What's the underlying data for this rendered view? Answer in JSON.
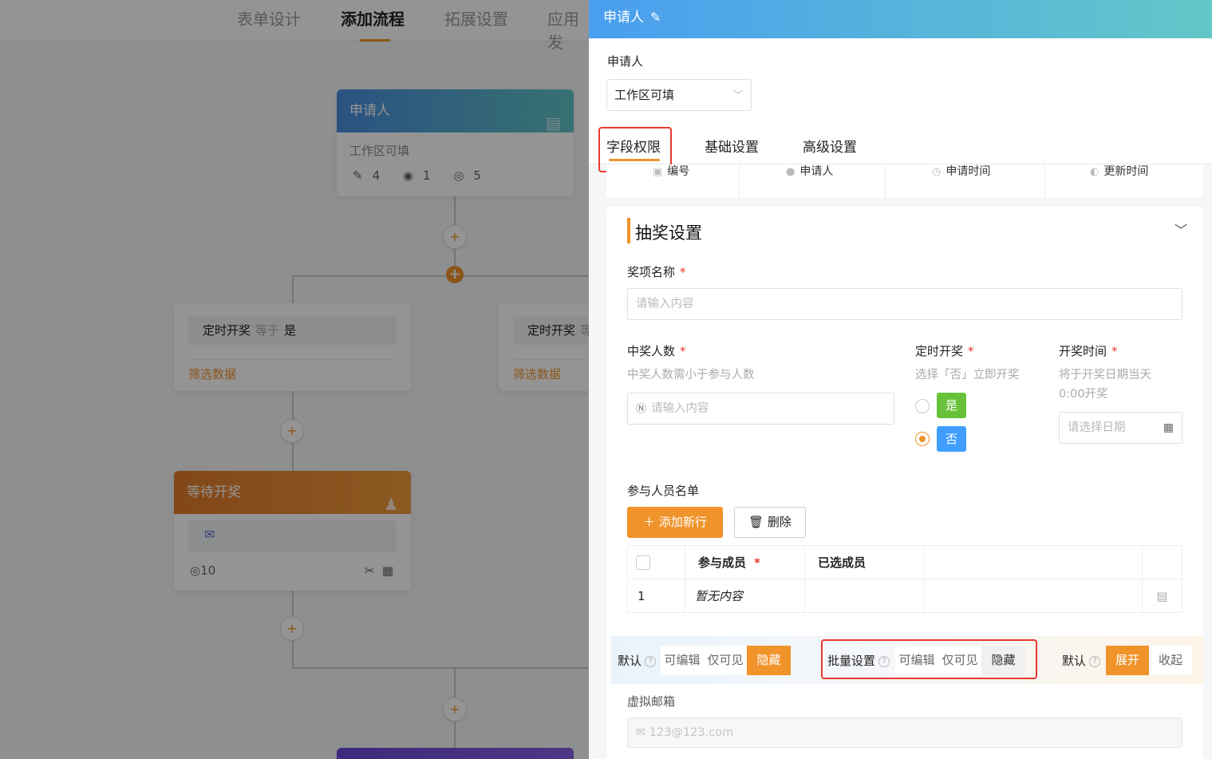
{
  "topnav": {
    "tabs": [
      {
        "label": "表单设计"
      },
      {
        "label": "添加流程"
      },
      {
        "label": "拓展设置"
      },
      {
        "label": "应用发"
      }
    ]
  },
  "flow": {
    "applicant_node": {
      "title": "申请人",
      "body": "工作区可填",
      "edit_count": "4",
      "view_count": "1",
      "hidden_count": "5"
    },
    "condition_left": {
      "field": "定时开奖",
      "op": "等于",
      "value": "是",
      "link": "筛选数据"
    },
    "condition_right": {
      "field": "定时开奖",
      "op": "等",
      "link": "筛选数据"
    },
    "wait_node": {
      "title": "等待开奖",
      "count": "10"
    },
    "plus": "+"
  },
  "drawer": {
    "title": "申请人",
    "approver_label": "申请人",
    "approver_select": "工作区可填",
    "tabs": [
      {
        "label": "字段权限"
      },
      {
        "label": "基础设置"
      },
      {
        "label": "高级设置"
      }
    ],
    "field_headers": [
      {
        "label": "编号"
      },
      {
        "label": "申请人"
      },
      {
        "label": "申请时间"
      },
      {
        "label": "更新时间"
      }
    ],
    "lottery": {
      "title": "抽奖设置",
      "prize_name_label": "奖项名称",
      "prize_name_placeholder": "请输入内容",
      "winners_label": "中奖人数",
      "winners_hint": "中奖人数需小于参与人数",
      "winners_placeholder": "请输入内容",
      "timed_label": "定时开奖",
      "timed_hint": "选择「否」立即开奖",
      "yes": "是",
      "no": "否",
      "time_label": "开奖时间",
      "time_hint_1": "将于开奖日期当天",
      "time_hint_2": "0:00开奖",
      "time_placeholder": "请选择日期",
      "participants_label": "参与人员名单",
      "add_row": "添加新行",
      "delete": "删除",
      "table_headers": {
        "member": "参与成员",
        "selected": "已选成员"
      },
      "rows": [
        {
          "index": "1",
          "member": "暂无内容"
        }
      ]
    },
    "settings": {
      "default_label": "默认",
      "batch_label": "批量设置",
      "editable": "可编辑",
      "visible": "仅可见",
      "hidden": "隐藏",
      "expand": "展开",
      "collapse": "收起"
    },
    "mail": {
      "label": "虚拟邮箱",
      "placeholder": "123@123.com"
    }
  },
  "colors": {
    "accent": "#f0932b",
    "highlight_red": "#e8392e",
    "yes_green": "#67c23a",
    "no_blue": "#409eff"
  }
}
